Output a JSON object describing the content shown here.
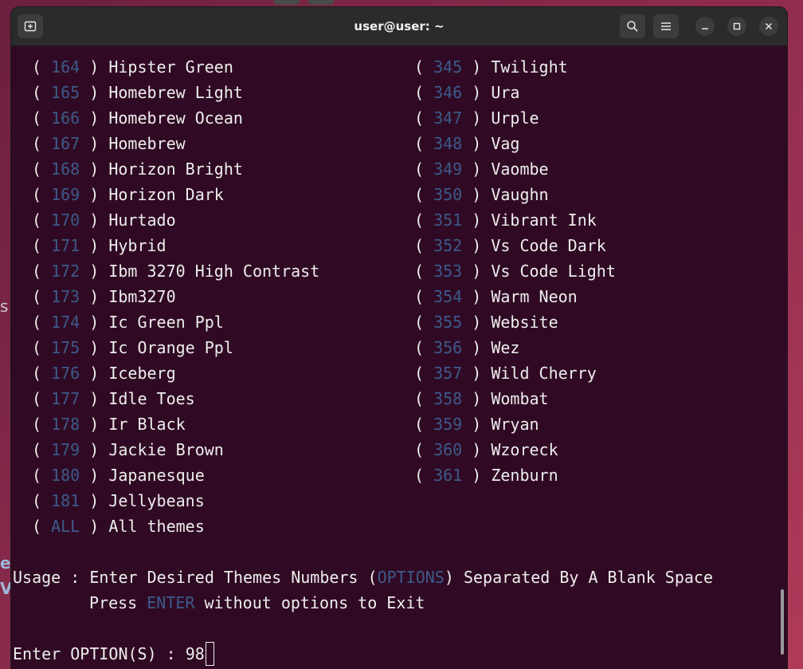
{
  "window": {
    "title": "user@user: ~"
  },
  "terminal": {
    "left_column": [
      {
        "num": "164",
        "name": "Hipster Green"
      },
      {
        "num": "165",
        "name": "Homebrew Light"
      },
      {
        "num": "166",
        "name": "Homebrew Ocean"
      },
      {
        "num": "167",
        "name": "Homebrew"
      },
      {
        "num": "168",
        "name": "Horizon Bright"
      },
      {
        "num": "169",
        "name": "Horizon Dark"
      },
      {
        "num": "170",
        "name": "Hurtado"
      },
      {
        "num": "171",
        "name": "Hybrid"
      },
      {
        "num": "172",
        "name": "Ibm 3270 High Contrast"
      },
      {
        "num": "173",
        "name": "Ibm3270"
      },
      {
        "num": "174",
        "name": "Ic Green Ppl"
      },
      {
        "num": "175",
        "name": "Ic Orange Ppl"
      },
      {
        "num": "176",
        "name": "Iceberg"
      },
      {
        "num": "177",
        "name": "Idle Toes"
      },
      {
        "num": "178",
        "name": "Ir Black"
      },
      {
        "num": "179",
        "name": "Jackie Brown"
      },
      {
        "num": "180",
        "name": "Japanesque"
      },
      {
        "num": "181",
        "name": "Jellybeans"
      },
      {
        "num": "ALL",
        "name": "All themes"
      }
    ],
    "right_column": [
      {
        "num": "345",
        "name": "Twilight"
      },
      {
        "num": "346",
        "name": "Ura"
      },
      {
        "num": "347",
        "name": "Urple"
      },
      {
        "num": "348",
        "name": "Vag"
      },
      {
        "num": "349",
        "name": "Vaombe"
      },
      {
        "num": "350",
        "name": "Vaughn"
      },
      {
        "num": "351",
        "name": "Vibrant Ink"
      },
      {
        "num": "352",
        "name": "Vs Code Dark"
      },
      {
        "num": "353",
        "name": "Vs Code Light"
      },
      {
        "num": "354",
        "name": "Warm Neon"
      },
      {
        "num": "355",
        "name": "Website"
      },
      {
        "num": "356",
        "name": "Wez"
      },
      {
        "num": "357",
        "name": "Wild Cherry"
      },
      {
        "num": "358",
        "name": "Wombat"
      },
      {
        "num": "359",
        "name": "Wryan"
      },
      {
        "num": "360",
        "name": "Wzoreck"
      },
      {
        "num": "361",
        "name": "Zenburn"
      }
    ],
    "usage": {
      "prefix": "Usage : Enter Desired Themes Numbers (",
      "options_word": "OPTIONS",
      "suffix": ") Separated By A Blank Space",
      "press_prefix": "Press ",
      "enter_word": "ENTER",
      "press_suffix": " without options to Exit"
    },
    "prompt": {
      "label": "Enter OPTION(S) : ",
      "value": "98"
    }
  },
  "desktop": {
    "fragment_s": "s",
    "fragment_e": "e",
    "fragment_v": "V"
  },
  "colors": {
    "terminal_bg": "#300a24",
    "number_color": "#3d5a8a",
    "text_color": "#eeeeec"
  }
}
